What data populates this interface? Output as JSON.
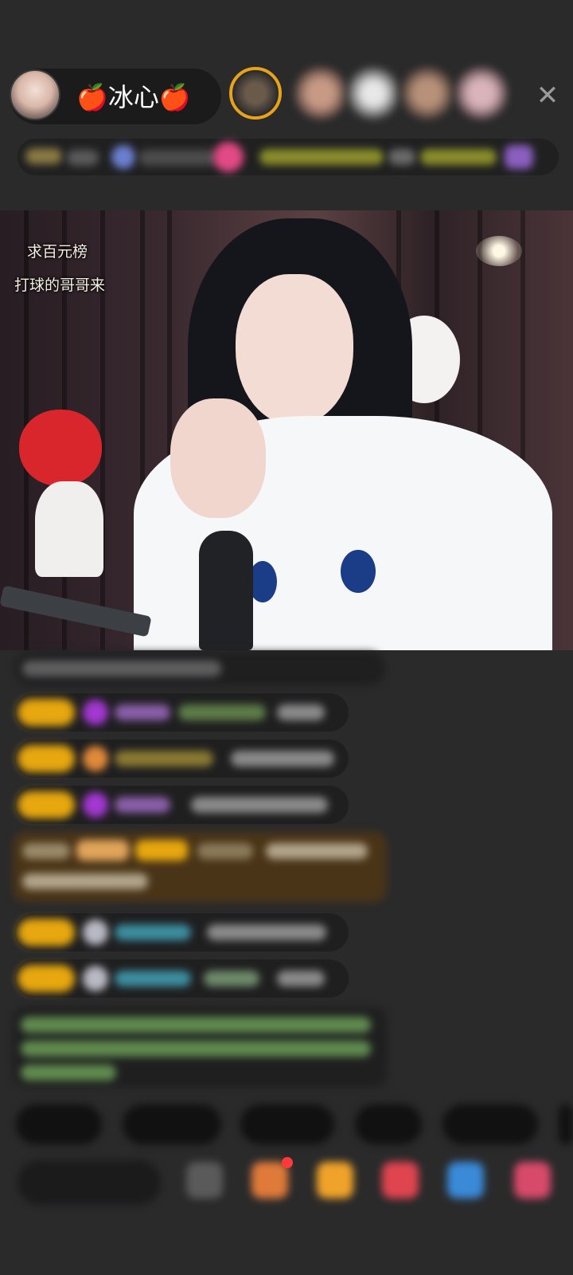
{
  "header": {
    "host_name": "🍎冰心🍎",
    "avatar": "host-avatar",
    "viewers": [
      {
        "name": "viewer-1",
        "color": "#d88a2a"
      },
      {
        "name": "viewer-2",
        "color": "#b78a74"
      },
      {
        "name": "viewer-3",
        "color": "#c9c9c9"
      },
      {
        "name": "viewer-4",
        "color": "#a7826e"
      },
      {
        "name": "viewer-5",
        "color": "#c9a7ad"
      }
    ],
    "close_icon": "close-icon",
    "close_glyph": "✕"
  },
  "video": {
    "overlay_lines": [
      "求百元榜",
      "打球的哥哥来"
    ]
  },
  "colors": {
    "background": "#2a2a2b",
    "badge": "#e6a70f",
    "gift_row": "#4a3417",
    "accent_pink": "#e24a86"
  }
}
